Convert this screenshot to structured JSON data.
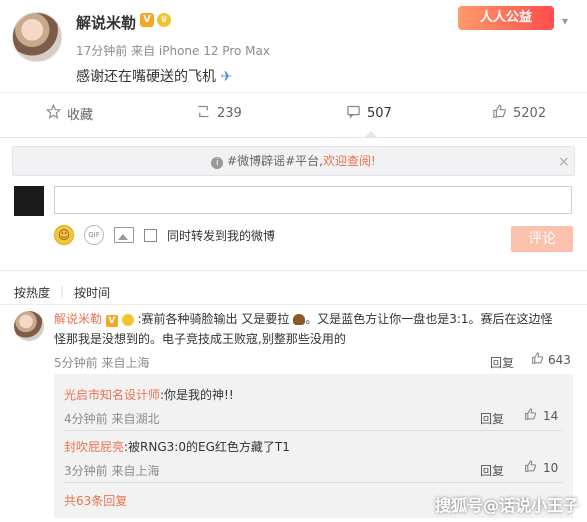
{
  "post": {
    "author": "解说米勒",
    "v_badge": "V",
    "fan_badge": "♛",
    "meta": "17分钟前 来自 iPhone 12 Pro Max",
    "content": "感谢还在嘴硬送的飞机",
    "content_emoji": "✈",
    "charity_label": "人人公益",
    "colors": {
      "accent": "#eb7350",
      "charity": "#ff5a4a"
    }
  },
  "actions": {
    "favorite": "收藏",
    "repost": "239",
    "comment": "507",
    "like": "5202"
  },
  "rumor": {
    "prefix": "#微博辟谣#平台,",
    "link": "欢迎查阅!"
  },
  "composer": {
    "repost_checkbox": "同时转发到我的微博",
    "submit": "评论",
    "gif": "GIF"
  },
  "sort": {
    "hot": "按热度",
    "time": "按时间"
  },
  "comment": {
    "author": "解说米勒",
    "v_badge": "V",
    "text_a": ":赛前各种骑脸输出 又是要拉",
    "text_b": "。又是蓝色方让你一盘也是3:1。赛后在这边怪",
    "text_c": "怪那我是没想到的。电子竞技成王败寇,别整那些没用的",
    "meta": "5分钟前 来自上海",
    "reply_label": "回复",
    "likes": "643"
  },
  "replies": [
    {
      "author": "光启市知名设计师",
      "text": ":你是我的神!!",
      "meta": "4分钟前 来自湖北",
      "reply_label": "回复",
      "likes": "14"
    },
    {
      "author": "封吹屁屁亮",
      "text": ":被RNG3:0的EG红色方藏了T1",
      "meta": "3分钟前 来自上海",
      "reply_label": "回复",
      "likes": "10"
    }
  ],
  "more_replies": "共63条回复",
  "watermark": "搜狐号@话说小王子"
}
